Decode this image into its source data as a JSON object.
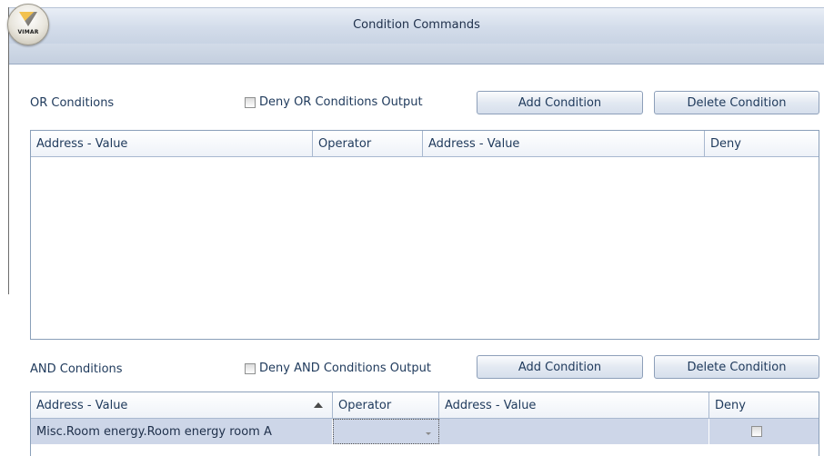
{
  "window": {
    "title": "Condition Commands",
    "logo_text": "VIMAR"
  },
  "or_section": {
    "label": "OR Conditions",
    "deny_output_label": "Deny OR Conditions Output",
    "deny_output_checked": false,
    "add_button": "Add Condition",
    "delete_button": "Delete Condition",
    "columns": [
      "Address - Value",
      "Operator",
      "Address - Value",
      "Deny"
    ],
    "rows": []
  },
  "and_section": {
    "label": "AND Conditions",
    "deny_output_label": "Deny AND Conditions Output",
    "deny_output_checked": false,
    "add_button": "Add Condition",
    "delete_button": "Delete Condition",
    "columns": [
      "Address - Value",
      "Operator",
      "Address - Value",
      "Deny"
    ],
    "sort_column": "Address - Value",
    "sort_direction": "ascending",
    "rows": [
      {
        "address_value_1": "Misc.Room energy.Room energy room A",
        "operator": "",
        "address_value_2": "",
        "deny": false
      }
    ]
  },
  "colors": {
    "text": "#1e395b",
    "selected_row": "#cdd6e8",
    "grid_border": "#8a9fb9"
  }
}
